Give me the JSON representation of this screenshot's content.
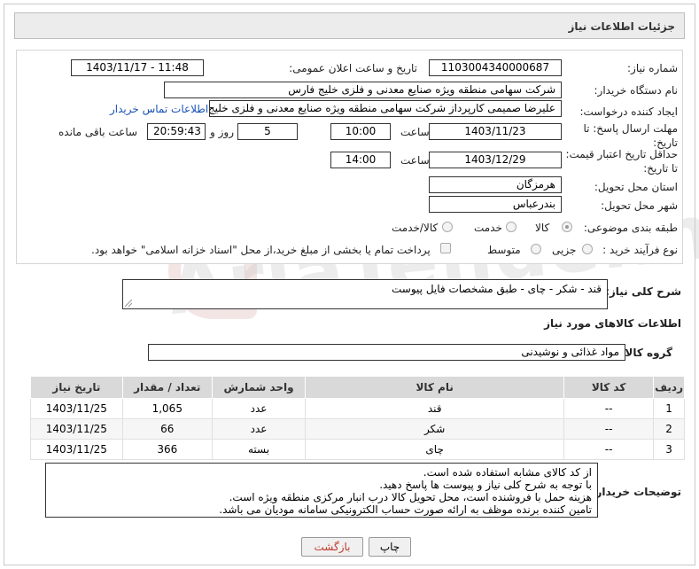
{
  "header": {
    "title": "جزئیات اطلاعات نیاز"
  },
  "fields": {
    "need_number_label": "شماره نیاز:",
    "need_number": "1103004340000687",
    "announce_label": "تاریخ و ساعت اعلان عمومی:",
    "announce_value": "1403/11/17 - 11:48",
    "buyer_label": "نام دستگاه خریدار:",
    "buyer_value": "شرکت سهامی منطقه ویژه صنایع معدنی و فلزی خلیج فارس",
    "creator_label": "ایجاد کننده درخواست:",
    "creator_value": "علیرضا صمیمی کارپرداز شرکت سهامی منطقه ویژه صنایع معدنی و فلزی خلیج فارس",
    "contact_link": "اطلاعات تماس خریدار",
    "deadline_label": "مهلت ارسال پاسخ: تا تاریخ:",
    "deadline_date": "1403/11/23",
    "hour_label": "ساعت",
    "deadline_time": "10:00",
    "days_count": "5",
    "days_label": "روز و",
    "remaining_time": "20:59:43",
    "remaining_label": "ساعت باقی مانده",
    "validity_label": "حداقل تاریخ اعتبار قیمت: تا تاریخ:",
    "validity_date": "1403/12/29",
    "validity_hour_label": "ساعت",
    "validity_time": "14:00",
    "province_label": "استان محل تحویل:",
    "province_value": "هرمزگان",
    "city_label": "شهر محل تحویل:",
    "city_value": "بندرعباس",
    "category_label": "طبقه بندی موضوعی:",
    "category_options": [
      "کالا",
      "خدمت",
      "کالا/خدمت"
    ],
    "process_label": "نوع فرآیند خرید :",
    "process_options": [
      "جزیی",
      "متوسط"
    ],
    "payment_note": "پرداخت تمام یا بخشی از مبلغ خرید،از محل \"اسناد خزانه اسلامی\" خواهد بود."
  },
  "summary": {
    "label": "شرح کلی نیاز:",
    "value": "قند - شکر - چای - طبق مشخصات فایل پیوست"
  },
  "items_section": {
    "title": "اطلاعات کالاهای مورد نیاز",
    "group_label": "گروه کالا:",
    "group_value": "مواد غذائی و نوشیدنی"
  },
  "table": {
    "headers": [
      "ردیف",
      "کد کالا",
      "نام کالا",
      "واحد شمارش",
      "تعداد / مقدار",
      "تاریخ نیاز"
    ],
    "rows": [
      [
        "1",
        "--",
        "قند",
        "عدد",
        "1,065",
        "1403/11/25"
      ],
      [
        "2",
        "--",
        "شکر",
        "عدد",
        "66",
        "1403/11/25"
      ],
      [
        "3",
        "--",
        "چای",
        "بسته",
        "366",
        "1403/11/25"
      ]
    ]
  },
  "notes": {
    "label": "توضیحات خریدار:",
    "lines": [
      "از کد کالای مشابه استفاده شده است.",
      "با توجه به شرح کلی نیاز و پیوست ها پاسخ دهید.",
      "هزینه حمل با فروشنده است، محل تحویل کالا درب انبار مرکزی منطقه ویژه است.",
      "تامین کننده برنده موظف به ارائه صورت حساب الکترونیکی سامانه مودیان می باشد."
    ]
  },
  "buttons": {
    "print": "چاپ",
    "back": "بازگشت"
  },
  "watermark": "AriaTender.net",
  "colors": {
    "link": "#1a52b5",
    "header_bg": "#ececec",
    "table_header_bg": "#d9d9d9",
    "back_button_text": "#c0392b"
  }
}
